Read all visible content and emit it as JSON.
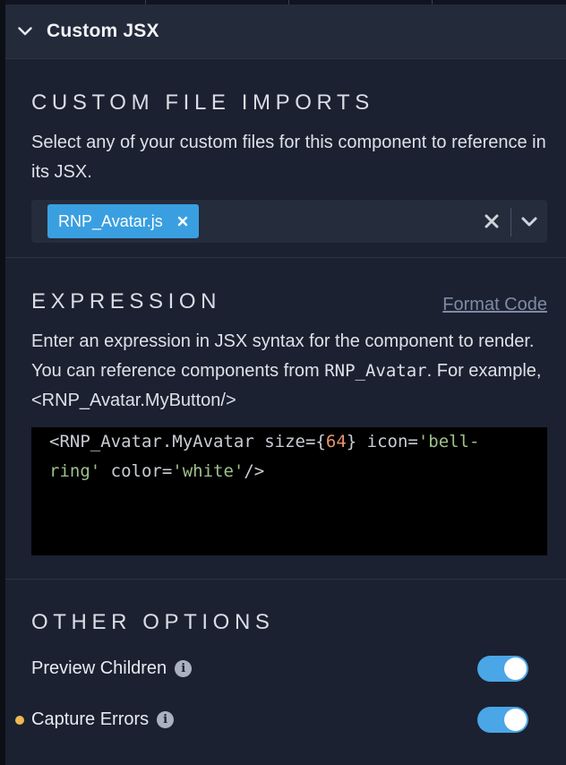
{
  "header": {
    "title": "Custom JSX",
    "expanded": true
  },
  "imports": {
    "title": "CUSTOM FILE IMPORTS",
    "description": "Select any of your custom files for this component to reference in its JSX.",
    "selected": [
      {
        "label": "RNP_Avatar.js"
      }
    ]
  },
  "expression": {
    "title": "EXPRESSION",
    "format_link": "Format Code",
    "desc_part1": "Enter an expression in JSX syntax for the component to render. You can reference components from",
    "desc_module": "RNP_Avatar",
    "desc_part2": ". For example, <RNP_Avatar.MyButton/>",
    "code": {
      "tag_open": "<RNP_Avatar.MyAvatar",
      "attr_size": " size=",
      "brace_open": "{",
      "size_value": "64",
      "brace_close": "}",
      "attr_icon": " icon=",
      "icon_value_1": "'bell-",
      "icon_value_2": "ring'",
      "attr_color": " color=",
      "color_value": "'white'",
      "tag_close": "/>"
    }
  },
  "options": {
    "title": "OTHER OPTIONS",
    "items": [
      {
        "label": "Preview Children",
        "enabled": true,
        "modified": false
      },
      {
        "label": "Capture Errors",
        "enabled": true,
        "modified": true
      }
    ]
  },
  "colors": {
    "background": "#1b2130",
    "header": "#232a3a",
    "accent": "#3a9fe0",
    "toggle_on": "#4aa6e6",
    "modified_dot": "#f0b851",
    "code_bg": "#000000"
  },
  "icons": {
    "collapse": "chevron-down-icon",
    "chip_remove": "close-icon",
    "clear": "close-icon",
    "dropdown": "chevron-down-icon",
    "info": "info-icon"
  }
}
